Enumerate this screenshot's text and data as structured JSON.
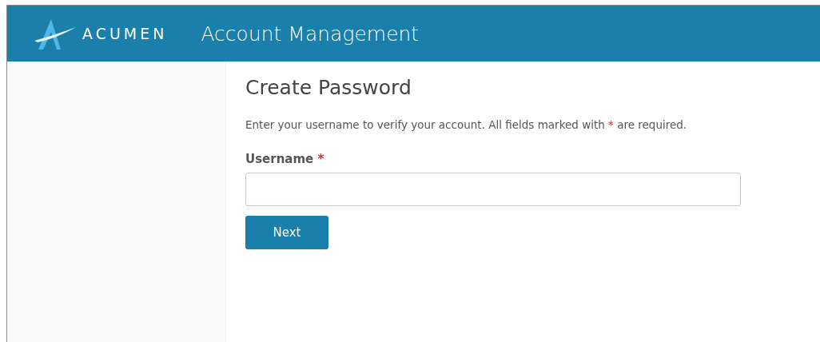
{
  "header": {
    "brand": "ACUMEN",
    "title": "Account Management"
  },
  "form": {
    "heading": "Create Password",
    "intro": [
      {
        "kind": "text",
        "text": "Enter your username to verify your account. All fields marked with "
      },
      {
        "kind": "required",
        "text": "*"
      },
      {
        "kind": "text",
        "text": " are required."
      }
    ],
    "fields": [
      {
        "label": "Username",
        "required_mark": "*"
      }
    ],
    "buttons": [
      "Next"
    ]
  }
}
